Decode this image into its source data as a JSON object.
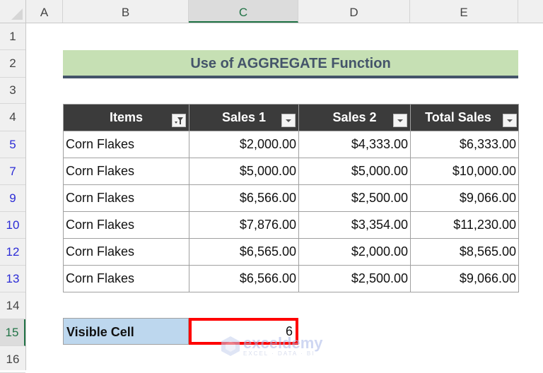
{
  "columns": [
    "A",
    "B",
    "C",
    "D",
    "E"
  ],
  "selected_column": "C",
  "rows": [
    "1",
    "2",
    "3",
    "4",
    "5",
    "7",
    "9",
    "10",
    "12",
    "13",
    "14",
    "15",
    "16"
  ],
  "selected_row": "15",
  "title": "Use of AGGREGATE Function",
  "table": {
    "headers": [
      {
        "label": "Items",
        "filter_icon": "filter-active-icon"
      },
      {
        "label": "Sales 1",
        "filter_icon": "dropdown-arrow-icon"
      },
      {
        "label": "Sales 2",
        "filter_icon": "dropdown-arrow-icon"
      },
      {
        "label": "Total Sales",
        "filter_icon": "dropdown-arrow-icon"
      }
    ],
    "rows": [
      {
        "item": "Corn Flakes",
        "sales1": "$2,000.00",
        "sales2": "$4,333.00",
        "total": "$6,333.00"
      },
      {
        "item": "Corn Flakes",
        "sales1": "$5,000.00",
        "sales2": "$5,000.00",
        "total": "$10,000.00"
      },
      {
        "item": "Corn Flakes",
        "sales1": "$6,566.00",
        "sales2": "$2,500.00",
        "total": "$9,066.00"
      },
      {
        "item": "Corn Flakes",
        "sales1": "$7,876.00",
        "sales2": "$3,354.00",
        "total": "$11,230.00"
      },
      {
        "item": "Corn Flakes",
        "sales1": "$6,565.00",
        "sales2": "$2,000.00",
        "total": "$8,565.00"
      },
      {
        "item": "Corn Flakes",
        "sales1": "$6,566.00",
        "sales2": "$2,500.00",
        "total": "$9,066.00"
      }
    ]
  },
  "summary": {
    "label": "Visible Cell",
    "value": "6"
  },
  "watermark": {
    "name": "exceldemy",
    "tagline": "EXCEL · DATA · BI"
  },
  "colors": {
    "title_fill": "#c6e0b4",
    "title_text": "#44546a",
    "header_fill": "#3b3b3b",
    "summary_fill": "#bdd7ee",
    "highlight_border": "#ff0000",
    "filtered_row_number": "#2b2bd6",
    "excel_green": "#217346"
  }
}
